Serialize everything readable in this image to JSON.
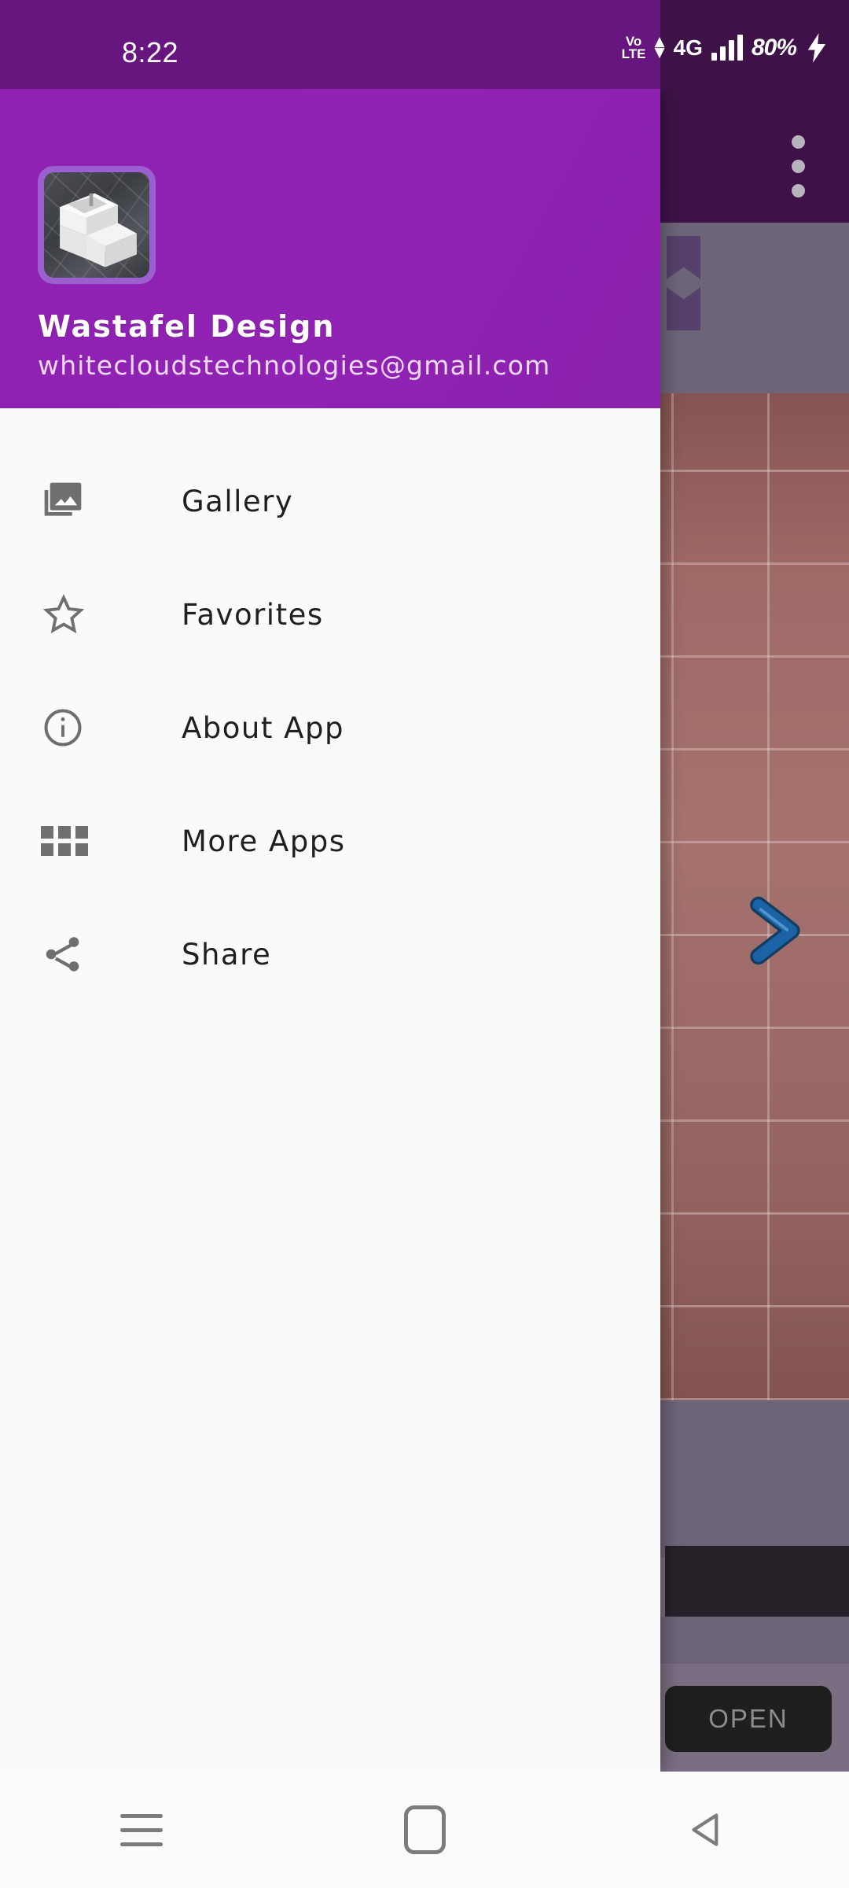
{
  "status_bar": {
    "time": "8:22",
    "volte_top": "Vo",
    "volte_bottom": "LTE",
    "data_arrows_icon": "data-updown-icon",
    "network": "4G",
    "signal_icon": "signal-bars-icon",
    "battery_percent": "80%",
    "charging_icon": "lightning-bolt-icon",
    "bg_color": "#66167e"
  },
  "drawer": {
    "header": {
      "app_icon_name": "app-icon-wastafel",
      "app_title": "Wastafel Design",
      "developer_email": "whitecloudstechnologies@gmail.com",
      "bg_color": "#9022b4"
    },
    "menu_items": [
      {
        "label": "Gallery",
        "icon": "photo-library-icon"
      },
      {
        "label": "Favorites",
        "icon": "star-outline-icon"
      },
      {
        "label": "About App",
        "icon": "info-circle-icon"
      },
      {
        "label": "More Apps",
        "icon": "grid-apps-icon"
      },
      {
        "label": "Share",
        "icon": "share-nodes-icon"
      }
    ],
    "bg_color": "#fafafa"
  },
  "background_app": {
    "toolbar": {
      "overflow_menu_icon": "overflow-menu-dots-icon",
      "bg_color": "#3e1248"
    },
    "bookmark_ribbon_icon": "bookmark-ribbon-icon",
    "photo_icon": "bathroom-photo",
    "next_arrow_icon": "chevron-right-arrow-icon",
    "next_arrow_color": "#1a5a96",
    "ad": {
      "open_label": "OPEN",
      "banner_name": "ad-banner"
    }
  },
  "nav_bar": {
    "recents_icon": "recents-hamburger-icon",
    "home_icon": "home-square-icon",
    "back_icon": "back-triangle-icon",
    "bg_color": "#fbfbfb"
  }
}
